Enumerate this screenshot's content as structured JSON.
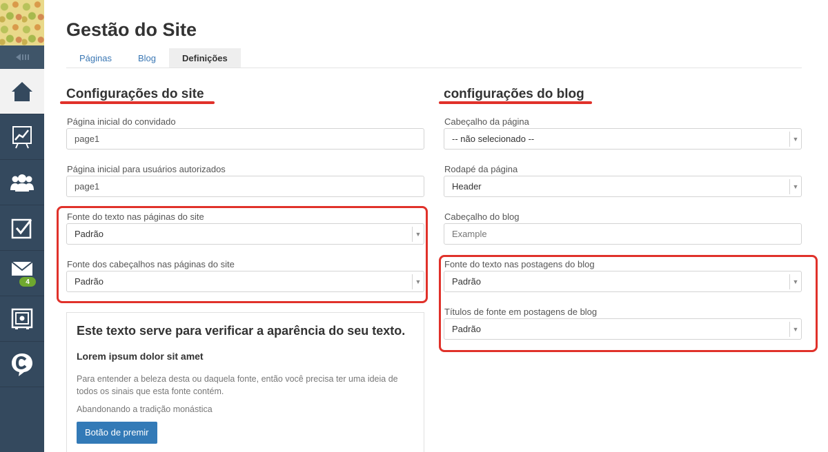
{
  "app": {
    "title": "Gestão do Site",
    "tabs": [
      {
        "label": "Páginas"
      },
      {
        "label": "Blog"
      },
      {
        "label": "Definições"
      }
    ]
  },
  "sidebar": {
    "items": [
      {
        "icon": "home-icon",
        "active": true
      },
      {
        "icon": "chart-icon"
      },
      {
        "icon": "users-icon"
      },
      {
        "icon": "checkbox-icon"
      },
      {
        "icon": "mail-icon",
        "badge": "4"
      },
      {
        "icon": "safe-icon"
      },
      {
        "icon": "chat-icon"
      }
    ]
  },
  "site": {
    "heading": "Configurações do site",
    "guest_home": {
      "label": "Página inicial do convidado",
      "value": "page1"
    },
    "auth_home": {
      "label": "Página inicial para usuários autorizados",
      "value": "page1"
    },
    "text_font": {
      "label": "Fonte do texto nas páginas do site",
      "value": "Padrão"
    },
    "heading_font": {
      "label": "Fonte dos cabeçalhos nas páginas do site",
      "value": "Padrão"
    }
  },
  "preview": {
    "title": "Este texto serve para verificar a aparência do seu texto.",
    "subtitle": "Lorem ipsum dolor sit amet",
    "paragraph": "Para entender a beleza desta ou daquela fonte, então você precisa ter uma ideia de todos os sinais que esta fonte contém.",
    "paragraph2": "Abandonando a tradição monástica",
    "button": "Botão de premir"
  },
  "blog": {
    "heading": "configurações do blog",
    "page_header": {
      "label": "Cabeçalho da página",
      "value": "-- não selecionado --"
    },
    "page_footer": {
      "label": "Rodapé da página",
      "value": "Header"
    },
    "blog_header": {
      "label": "Cabeçalho do blog",
      "placeholder": "Example"
    },
    "post_font": {
      "label": "Fonte do texto nas postagens do blog",
      "value": "Padrão"
    },
    "post_title_font": {
      "label": "Títulos de fonte em postagens de blog",
      "value": "Padrão"
    }
  },
  "colors": {
    "accent": "#337ab7",
    "highlight": "#e0312a",
    "sidebar": "#34495e",
    "badge": "#6fa82f"
  }
}
